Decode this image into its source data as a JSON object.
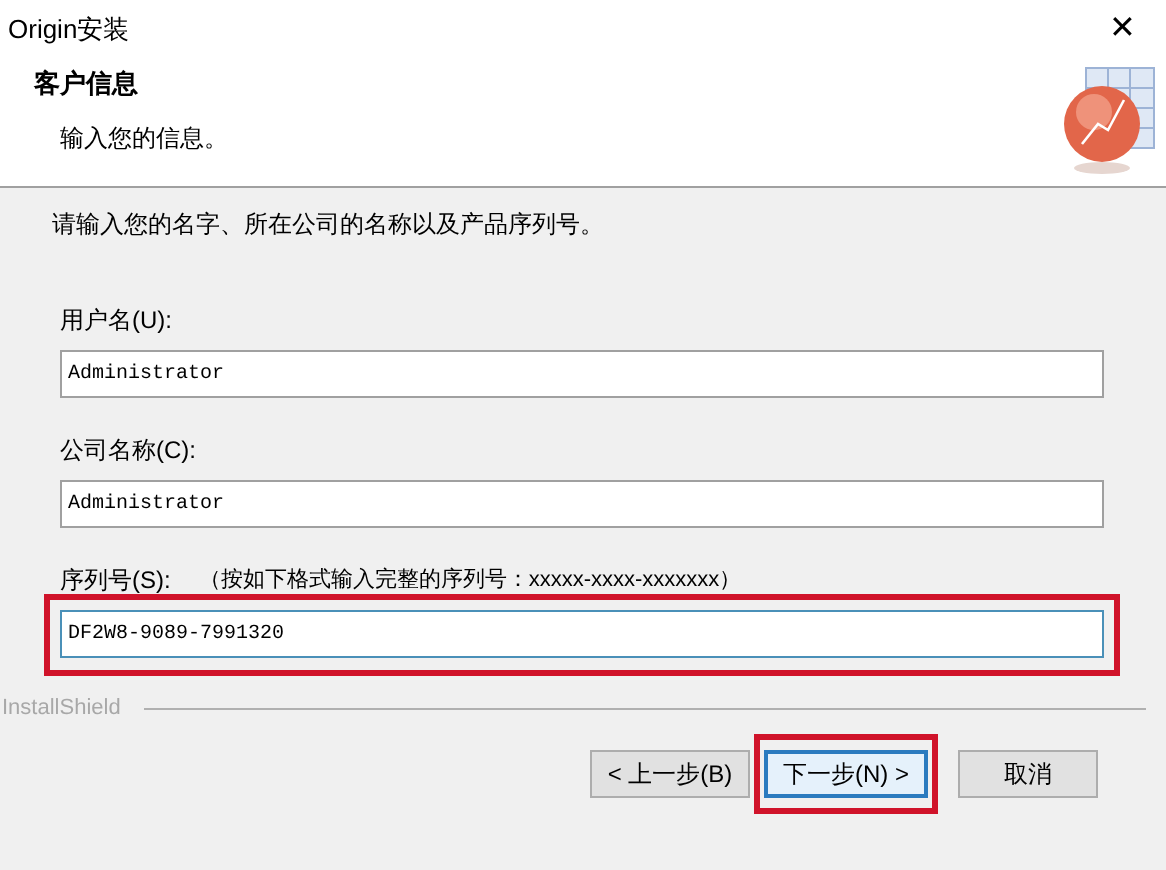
{
  "window": {
    "title": "Origin安装",
    "close": "✕"
  },
  "header": {
    "title": "客户信息",
    "subtitle": "输入您的信息。"
  },
  "instruction": "请输入您的名字、所在公司的名称以及产品序列号。",
  "fields": [
    {
      "label": "用户名(U):",
      "value": "Administrator",
      "highlighted": false
    },
    {
      "label": "公司名称(C):",
      "value": "Administrator",
      "highlighted": false
    },
    {
      "label": "序列号(S):",
      "hint": "（按如下格式输入完整的序列号：xxxxx-xxxx-xxxxxxx）",
      "value": "DF2W8-9089-7991320",
      "highlighted": true
    }
  ],
  "brand": "InstallShield",
  "buttons": [
    {
      "label": "< 上一步(B)",
      "highlighted": false,
      "selected": false
    },
    {
      "label": "下一步(N) >",
      "highlighted": true,
      "selected": true
    },
    {
      "label": "取消",
      "highlighted": false,
      "selected": false
    }
  ]
}
